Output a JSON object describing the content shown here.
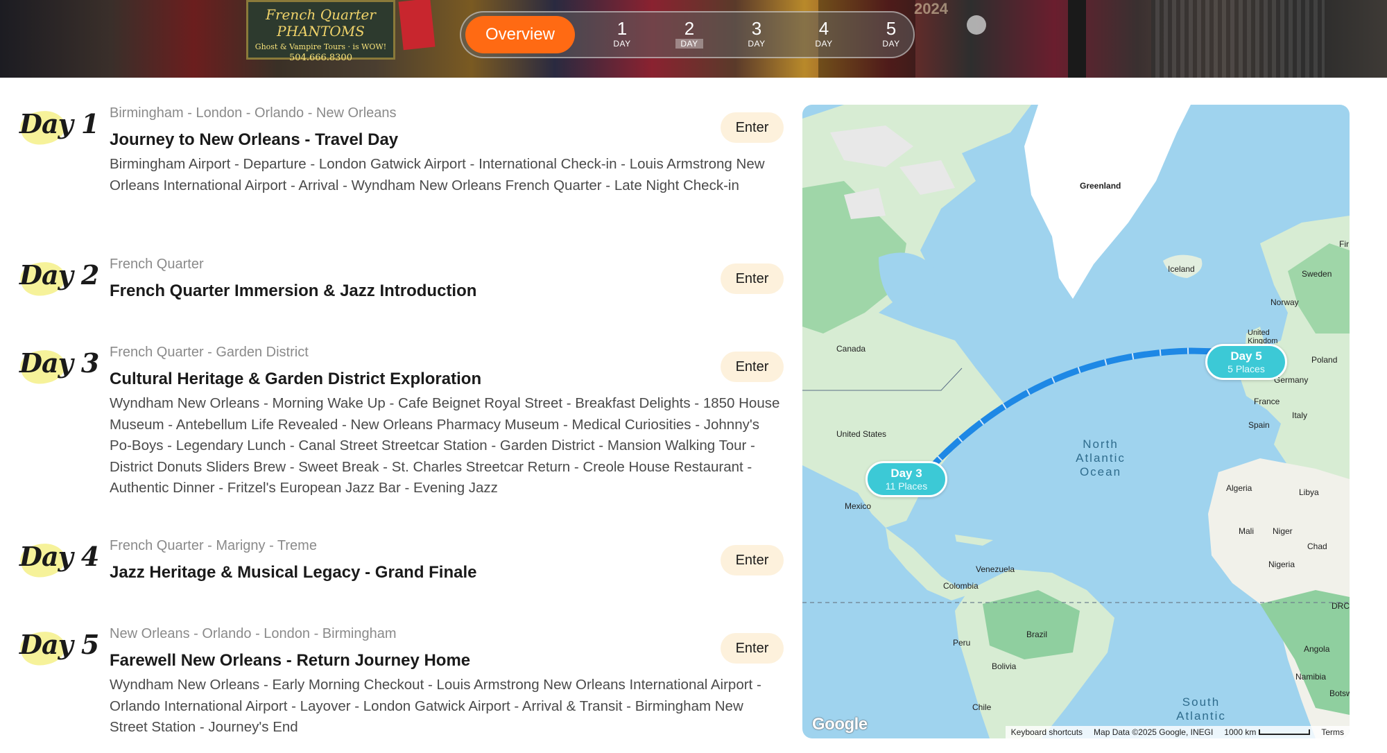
{
  "banner": {
    "sign_title": "French Quarter PHANTOMS",
    "sign_tagline": "Ghost & Vampire Tours · is WOW!",
    "sign_phone": "504.666.8300",
    "year_sign": "2024"
  },
  "nav": {
    "overview_label": "Overview",
    "tabs": [
      {
        "num": "1",
        "label": "DAY"
      },
      {
        "num": "2",
        "label": "DAY"
      },
      {
        "num": "3",
        "label": "DAY"
      },
      {
        "num": "4",
        "label": "DAY"
      },
      {
        "num": "5",
        "label": "DAY"
      }
    ],
    "active_tab": 2
  },
  "days": [
    {
      "badge": "Day 1",
      "route": "Birmingham - London - Orlando - New Orleans",
      "title": "Journey to New Orleans - Travel Day",
      "desc": "Birmingham Airport - Departure - London Gatwick Airport - International Check-in - Louis Armstrong New Orleans International Airport - Arrival - Wyndham New Orleans French Quarter - Late Night Check-in",
      "enter": "Enter"
    },
    {
      "badge": "Day 2",
      "route": "French Quarter",
      "title": "French Quarter Immersion & Jazz Introduction",
      "desc": "",
      "enter": "Enter"
    },
    {
      "badge": "Day 3",
      "route": "French Quarter - Garden District",
      "title": "Cultural Heritage & Garden District Exploration",
      "desc": "Wyndham New Orleans - Morning Wake Up - Cafe Beignet Royal Street - Breakfast Delights - 1850 House Museum - Antebellum Life Revealed - New Orleans Pharmacy Museum - Medical Curiosities - Johnny's Po-Boys - Legendary Lunch - Canal Street Streetcar Station - Garden District - Mansion Walking Tour - District Donuts Sliders Brew - Sweet Break - St. Charles Streetcar Return - Creole House Restaurant - Authentic Dinner - Fritzel's European Jazz Bar - Evening Jazz",
      "enter": "Enter"
    },
    {
      "badge": "Day 4",
      "route": "French Quarter - Marigny - Treme",
      "title": "Jazz Heritage & Musical Legacy - Grand Finale",
      "desc": "",
      "enter": "Enter"
    },
    {
      "badge": "Day 5",
      "route": "New Orleans - Orlando - London - Birmingham",
      "title": "Farewell New Orleans - Return Journey Home",
      "desc": "Wyndham New Orleans - Early Morning Checkout - Louis Armstrong New Orleans International Airport - Orlando International Airport - Layover - London Gatwick Airport - Arrival & Transit - Birmingham New Street Station - Journey's End",
      "enter": "Enter"
    }
  ],
  "map": {
    "labels": {
      "greenland": "Greenland",
      "iceland": "Iceland",
      "canada": "Canada",
      "united_states": "United States",
      "mexico": "Mexico",
      "venezuela": "Venezuela",
      "colombia": "Colombia",
      "peru": "Peru",
      "brazil": "Brazil",
      "bolivia": "Bolivia",
      "chile": "Chile",
      "sweden": "Sweden",
      "norway": "Norway",
      "fin": "Fir",
      "united_kingdom": "United Kingdom",
      "poland": "Poland",
      "germany": "Germany",
      "france": "France",
      "spain": "Spain",
      "italy": "Italy",
      "algeria": "Algeria",
      "libya": "Libya",
      "mali": "Mali",
      "niger": "Niger",
      "chad": "Chad",
      "nigeria": "Nigeria",
      "drc": "DRC",
      "angola": "Angola",
      "namibia": "Namibia",
      "botswana": "Botsw"
    },
    "oceans": {
      "north_atlantic": [
        "North",
        "Atlantic",
        "Ocean"
      ],
      "south_atlantic": [
        "South",
        "Atlantic"
      ]
    },
    "pins": [
      {
        "title": "Day 3",
        "subtitle": "11 Places"
      },
      {
        "title": "Day 5",
        "subtitle": "5 Places"
      }
    ],
    "google_logo": "Google",
    "attribution": {
      "shortcuts": "Keyboard shortcuts",
      "data": "Map Data ©2025 Google, INEGI",
      "scale": "1000 km",
      "terms": "Terms"
    },
    "colors": {
      "water": "#9fd3ee",
      "land": "#d7ecd3",
      "forest": "#8fcf9f",
      "ice": "#ffffff",
      "route": "#1e88e5",
      "pin": "#3cc9d6"
    }
  },
  "colors": {
    "accent": "#ff6a13",
    "enter_bg": "#fdf1dc",
    "badge_highlight": "#f6f29a"
  }
}
